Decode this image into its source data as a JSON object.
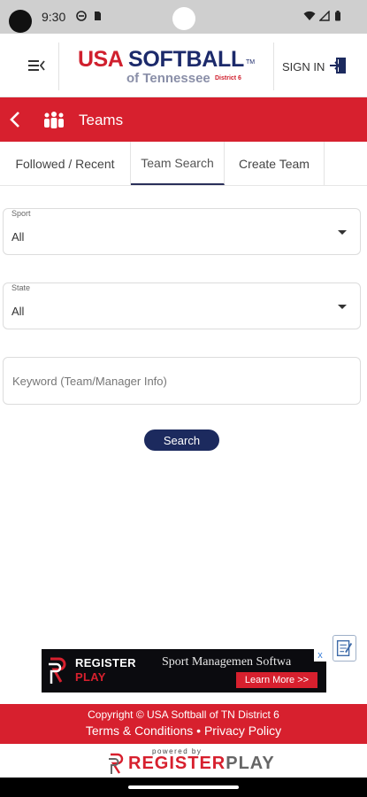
{
  "status_bar": {
    "time": "9:30"
  },
  "header": {
    "logo": {
      "usa": "USA",
      "softball": "SOFTBALL",
      "tm": "TM",
      "sub": "of Tennessee",
      "district": "District 6"
    },
    "sign_in_label": "SIGN IN"
  },
  "titlebar": {
    "title": "Teams"
  },
  "tabs": [
    {
      "label": "Followed / Recent",
      "active": false
    },
    {
      "label": "Team Search",
      "active": true
    },
    {
      "label": "Create Team",
      "active": false
    }
  ],
  "form": {
    "sport": {
      "label": "Sport",
      "value": "All"
    },
    "state": {
      "label": "State",
      "value": "All"
    },
    "keyword": {
      "placeholder": "Keyword (Team/Manager Info)",
      "value": ""
    },
    "search_label": "Search"
  },
  "ad": {
    "brand_line1": "REGISTER",
    "brand_line2": "PLAY",
    "tagline": "Sport Managemen Softwa",
    "cta": "Learn More >>",
    "close": "x"
  },
  "footer": {
    "copyright": "Copyright © USA Softball of TN District 6",
    "terms": "Terms & Conditions",
    "separator": "•",
    "privacy": "Privacy Policy"
  },
  "powered": {
    "powered_by": "powered by",
    "register": "REGISTER",
    "play": "PLAY"
  },
  "colors": {
    "brand_red": "#d7202e",
    "brand_navy": "#1c2a5e"
  }
}
